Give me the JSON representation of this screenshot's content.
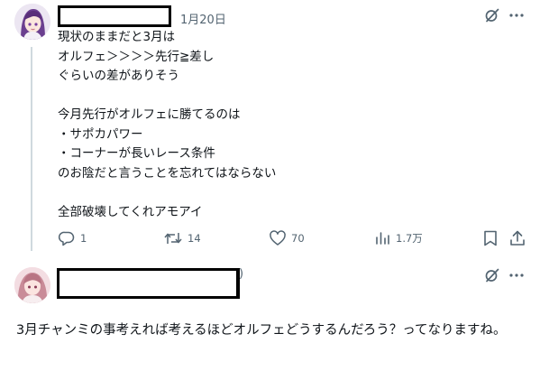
{
  "tweet": {
    "date": "1月20日",
    "text": "現状のままだと3月は\nオルフェ＞＞＞＞先行≧差し\nぐらいの差がありそう\n\n今月先行がオルフェに勝てるのは\n・サポカパワー\n・コーナーが長いレース条件\nのお陰だと言うことを忘れてはならない\n\n全部破壊してくれアモアイ",
    "actions": {
      "reply_count": "1",
      "retweet_count": "14",
      "like_count": "70",
      "view_count": "1.7万"
    }
  },
  "reply": {
    "stray_char": ")",
    "text": "3月チャンミの事考えれば考えるほどオルフェどうするんだろう？ってなりますね。"
  },
  "icons": {
    "grok": "grok-icon",
    "more": "more-icon",
    "reply": "reply-icon",
    "retweet": "retweet-icon",
    "like": "like-icon",
    "views": "views-icon",
    "bookmark": "bookmark-icon",
    "share": "share-icon"
  },
  "colors": {
    "text": "#0f1419",
    "secondary": "#536471",
    "thread_line": "#cfd9de"
  }
}
